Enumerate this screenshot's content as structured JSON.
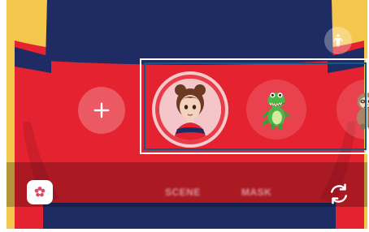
{
  "background": {
    "color": "#f2c74c",
    "sweater_red": "#e5222f",
    "sweater_navy": "#1f2b63"
  },
  "controls": {
    "add_sticker_icon": "plus-icon",
    "body_icon": "person-icon",
    "effects_icon": "flower-icon",
    "switch_camera_icon": "rotate-camera-icon"
  },
  "avatars": [
    {
      "name": "my-emoji",
      "selected": true
    },
    {
      "name": "dinosaur",
      "selected": false
    },
    {
      "name": "sloth",
      "selected": false
    }
  ],
  "modes": {
    "scene": "SCENE",
    "mask": "MASK"
  },
  "highlight_color": "#0e5a8a"
}
